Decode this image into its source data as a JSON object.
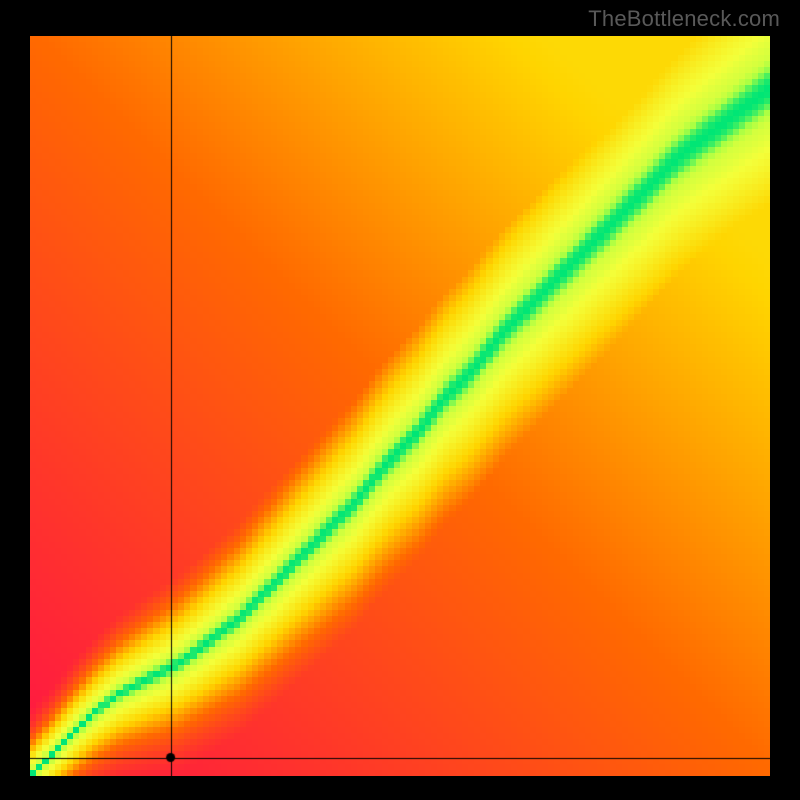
{
  "watermark": "TheBottleneck.com",
  "chart_data": {
    "type": "heatmap",
    "title": "",
    "xlabel": "",
    "ylabel": "",
    "xlim": [
      0,
      100
    ],
    "ylim": [
      0,
      100
    ],
    "grid": false,
    "value_meaning": "compatibility_score_0_bad_1_good",
    "ridge_description": "optimal pairing curve where score peaks (green)",
    "ridge": [
      [
        0,
        0
      ],
      [
        4,
        4
      ],
      [
        8,
        8
      ],
      [
        12,
        11
      ],
      [
        16,
        13
      ],
      [
        20,
        15
      ],
      [
        24,
        18
      ],
      [
        28,
        21
      ],
      [
        32,
        25
      ],
      [
        36,
        29
      ],
      [
        40,
        33
      ],
      [
        44,
        37
      ],
      [
        48,
        42
      ],
      [
        52,
        46
      ],
      [
        56,
        51
      ],
      [
        60,
        55
      ],
      [
        64,
        60
      ],
      [
        68,
        64
      ],
      [
        72,
        68
      ],
      [
        76,
        72
      ],
      [
        80,
        76
      ],
      [
        84,
        80
      ],
      [
        88,
        84
      ],
      [
        92,
        87
      ],
      [
        96,
        90
      ],
      [
        100,
        93
      ]
    ],
    "ridge_width_start": 2,
    "ridge_width_end": 11,
    "color_stops": [
      {
        "v": 0.0,
        "hex": "#ff1744"
      },
      {
        "v": 0.35,
        "hex": "#ff6a00"
      },
      {
        "v": 0.6,
        "hex": "#ffd500"
      },
      {
        "v": 0.8,
        "hex": "#f4ff3a"
      },
      {
        "v": 0.93,
        "hex": "#aaff44"
      },
      {
        "v": 1.0,
        "hex": "#00e676"
      }
    ],
    "marker": {
      "x": 19,
      "y": 2.5,
      "style": "crosshair-full-extent-with-dot"
    },
    "pixelated": true,
    "grid_resolution": 120
  }
}
